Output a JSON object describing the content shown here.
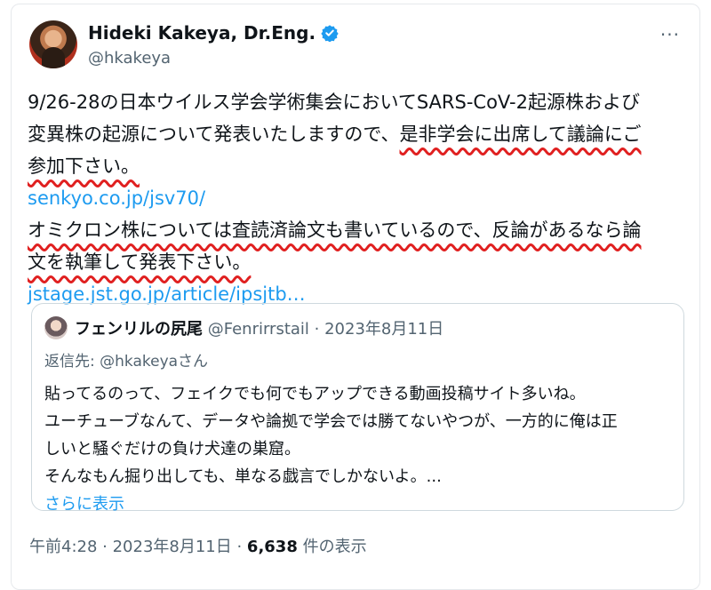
{
  "author": {
    "display_name": "Hideki Kakeya, Dr.Eng.",
    "handle": "@hkakeya",
    "verified_icon": "verified-badge-icon",
    "more_label": "···"
  },
  "tweet": {
    "lines": [
      "9/26-28の日本ウイルス学会学術集会においてSARS-CoV-2起源株および",
      "変異株の起源について発表いたしますので、",
      "是非学会に出席して議論にご",
      "参加下さい。",
      "senkyo.co.jp/jsv70/",
      "オミクロン株については査読済論文も書いているので、反論があるなら論",
      "文を執筆して発表下さい。",
      "jstage.jst.go.jp/article/ipsjtb…"
    ]
  },
  "quote": {
    "name": "フェンリルの尻尾",
    "meta": " @Fenrirrstail · 2023年8月11日",
    "reply_prefix": "返信先: ",
    "reply_mention": "@hkakeyaさん",
    "body": [
      "貼ってるのって、フェイクでも何でもアップできる動画投稿サイト多いね。",
      "ユーチューブなんて、データや論拠で学会では勝てないやつが、一方的に俺は正",
      "しいと騒ぐだけの負け犬達の巣窟。",
      "そんなもん掘り出しても、単なる戯言でしかないよ。..."
    ],
    "show_more": "さらに表示"
  },
  "footer": {
    "timestamp": "午前4:28 · 2023年8月11日 · ",
    "views_count": "6,638",
    "views_label": " 件の表示"
  },
  "colors": {
    "link": "#1d9bf0",
    "underline_annotation": "#e02020",
    "secondary_text": "#536471"
  }
}
